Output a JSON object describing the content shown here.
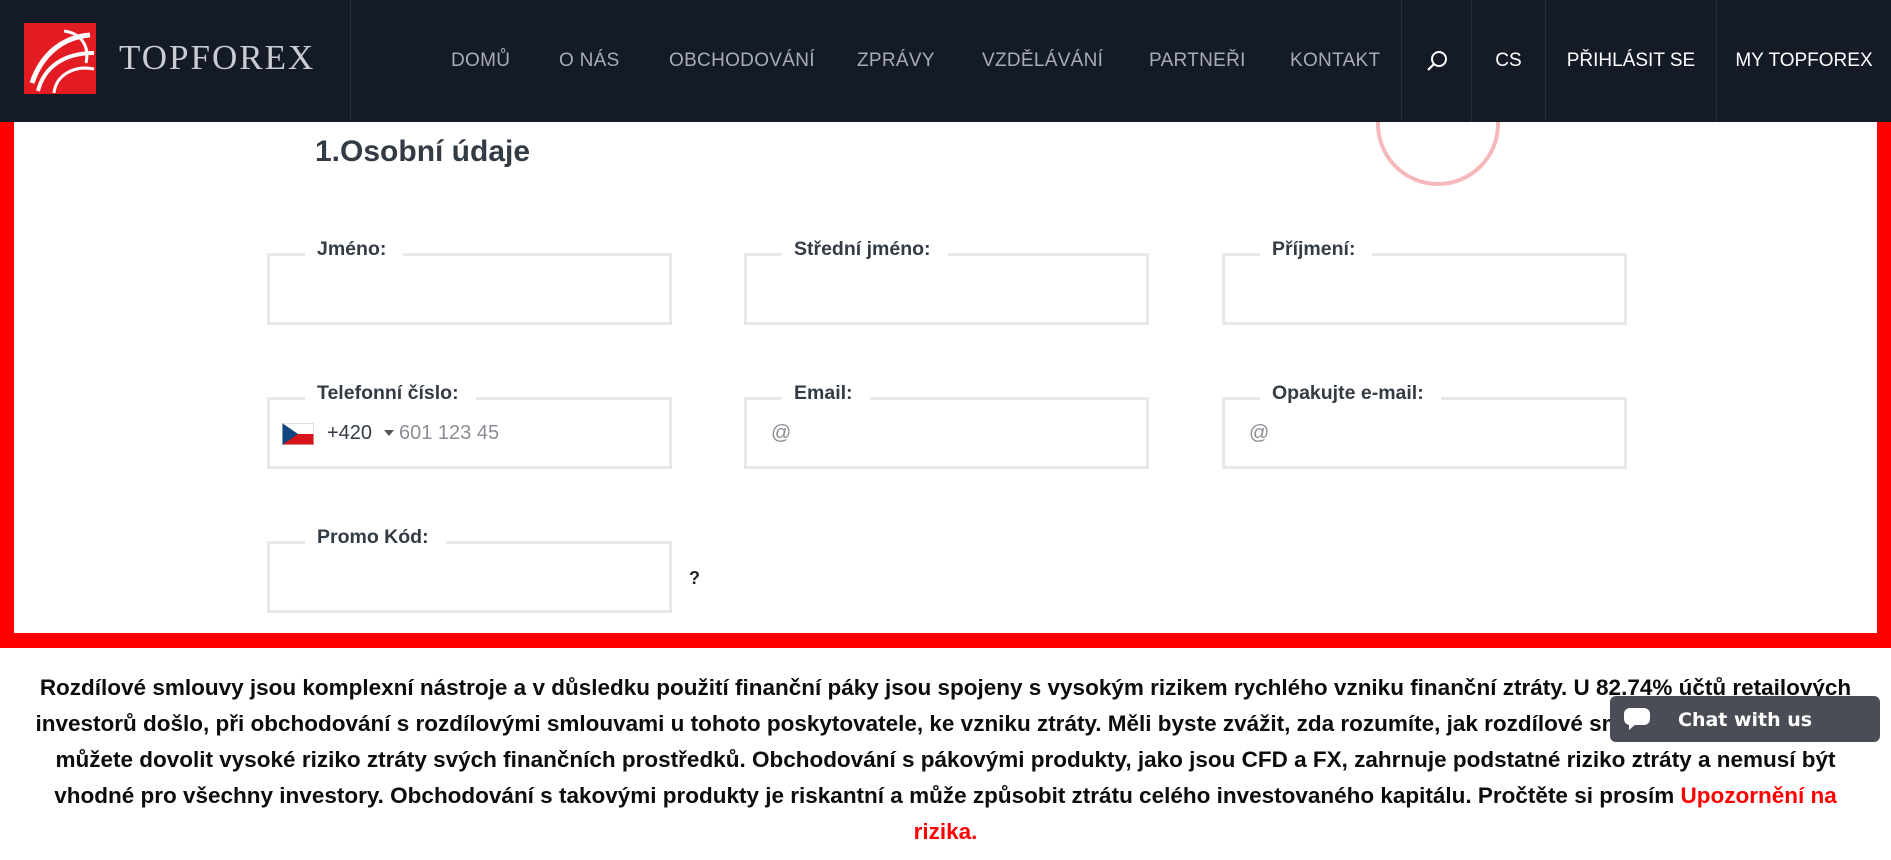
{
  "header": {
    "brand": "TOPFOREX",
    "nav": [
      "DOMŮ",
      "O NÁS",
      "OBCHODOVÁNÍ",
      "ZPRÁVY",
      "VZDĚLÁVÁNÍ",
      "PARTNEŘI",
      "KONTAKT"
    ],
    "search_icon": "search-icon",
    "language": "CS",
    "login": "PŘIHLÁSIT SE",
    "my_account": "MY TOPFOREX"
  },
  "form": {
    "section_title": "1.Osobní údaje",
    "fields": {
      "first_name": {
        "label": "Jméno:",
        "value": ""
      },
      "middle_name": {
        "label": "Střední jméno:",
        "value": ""
      },
      "last_name": {
        "label": "Příjmení:",
        "value": ""
      },
      "phone": {
        "label": "Telefonní číslo:",
        "country_code": "+420",
        "placeholder": "601 123 45",
        "flag": "cz-flag-icon"
      },
      "email": {
        "label": "Email:",
        "prefix": "@",
        "value": ""
      },
      "email_repeat": {
        "label": "Opakujte e-mail:",
        "prefix": "@",
        "value": ""
      },
      "promo": {
        "label": "Promo Kód:",
        "value": "",
        "help": "?"
      }
    }
  },
  "risk_warning": {
    "text": "Rozdílové smlouvy jsou komplexní nástroje a v důsledku použití finanční páky jsou spojeny s vysokým rizikem rychlého vzniku finanční ztráty. U 82.74% účtů retailových investorů došlo, při obchodování s rozdílovými smlouvami u tohoto poskytovatele, ke vzniku ztráty. Měli byste zvážit, zda rozumíte, jak rozdílové smlouvy fungují, a zda si můžete dovolit vysoké riziko ztráty svých finančních prostředků. Obchodování s pákovými produkty, jako jsou CFD a FX, zahrnuje podstatné riziko ztráty a nemusí být vhodné pro všechny investory. Obchodování s takovými produkty je riskantní a může způsobit ztrátu celého investovaného kapitálu. Pročtěte si prosím ",
    "link": "Upozornění na rizika."
  },
  "chat": {
    "label": "Chat with us"
  },
  "colors": {
    "header_bg": "#151a27",
    "brand_red": "#e31b23",
    "frame_red": "#ff0000"
  }
}
